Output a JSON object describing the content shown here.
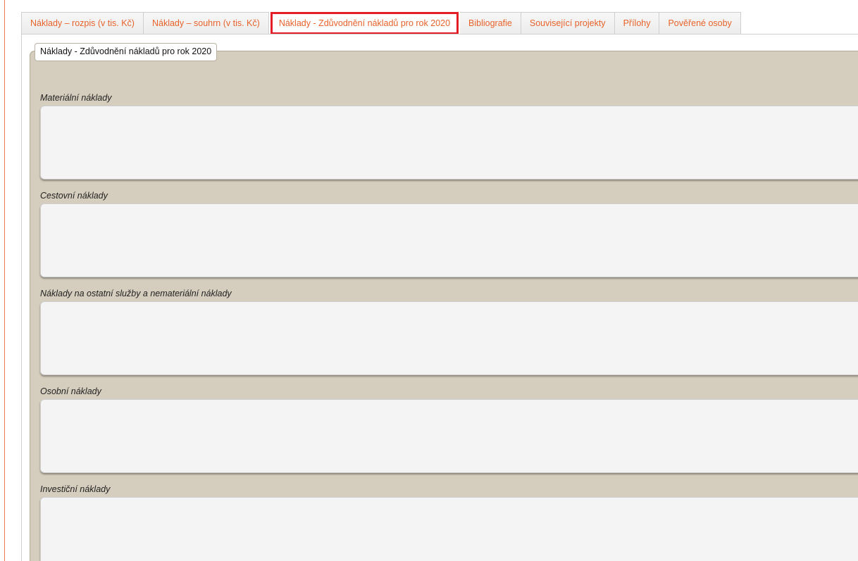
{
  "tabs": [
    {
      "label": "Náklady – rozpis (v tis. Kč)"
    },
    {
      "label": "Náklady – souhrn (v tis. Kč)"
    },
    {
      "label": "Náklady - Zdůvodnění nákladů pro rok 2020"
    },
    {
      "label": "Bibliografie"
    },
    {
      "label": "Související projekty"
    },
    {
      "label": "Přílohy"
    },
    {
      "label": "Pověřené osoby"
    }
  ],
  "active_tab": "Náklady - Zdůvodnění nákladů pro rok 2020",
  "panel": {
    "legend": "Náklady - Zdůvodnění nákladů pro rok 2020",
    "sections": [
      {
        "label": "Materiální náklady",
        "value": ""
      },
      {
        "label": "Cestovní náklady",
        "value": ""
      },
      {
        "label": "Náklady na ostatní služby a nemateriální náklady",
        "value": ""
      },
      {
        "label": "Osobní náklady",
        "value": ""
      },
      {
        "label": "Investiční náklady",
        "value": ""
      }
    ]
  },
  "colors": {
    "tab_text": "#e8622a",
    "active_highlight": "#e41e26",
    "panel_bg": "#d5cdbd",
    "field_bg": "#f4f4f4"
  }
}
